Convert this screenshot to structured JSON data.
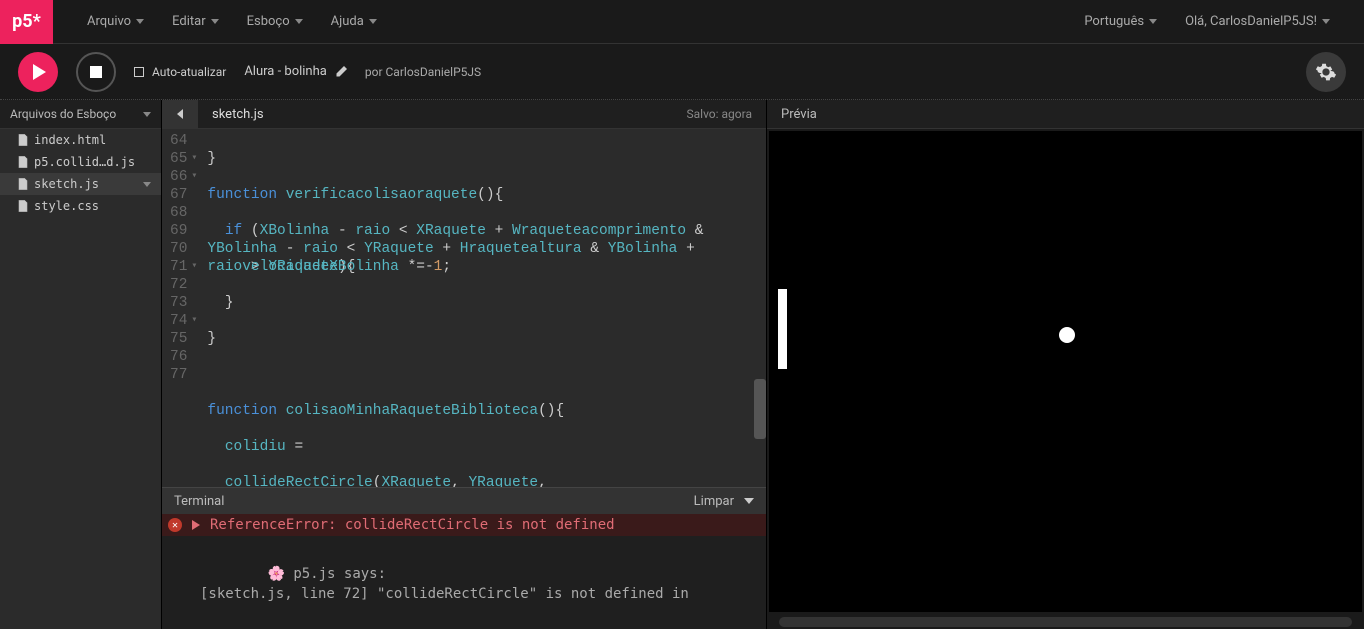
{
  "logo": "p5*",
  "menu": {
    "arquivo": "Arquivo",
    "editar": "Editar",
    "esboco": "Esboço",
    "ajuda": "Ajuda"
  },
  "right": {
    "language": "Português",
    "greeting": "Olá, CarlosDanielP5JS!"
  },
  "toolbar": {
    "autorefresh": "Auto-atualizar",
    "sketch_name": "Alura - bolinha",
    "by_prefix": "por",
    "by_user": "CarlosDanielP5JS"
  },
  "sidebar": {
    "title": "Arquivos do Esboço",
    "files": [
      "index.html",
      "p5.collid…d.js",
      "sketch.js",
      "style.css"
    ],
    "active": "sketch.js"
  },
  "editor": {
    "tab": "sketch.js",
    "save_status": "Salvo: agora",
    "line_numbers": [
      "64",
      "65",
      "66",
      "67",
      "68",
      "69",
      "70",
      "71",
      "72",
      "73",
      "74",
      "75",
      "76",
      "77"
    ]
  },
  "terminal": {
    "title": "Terminal",
    "clear": "Limpar",
    "error": "ReferenceError: collideRectCircle is not defined",
    "msg_line1": "p5.js says:",
    "msg_line2": "[sketch.js, line 72] \"collideRectCircle\" is not defined in"
  },
  "preview": {
    "title": "Prévia"
  }
}
